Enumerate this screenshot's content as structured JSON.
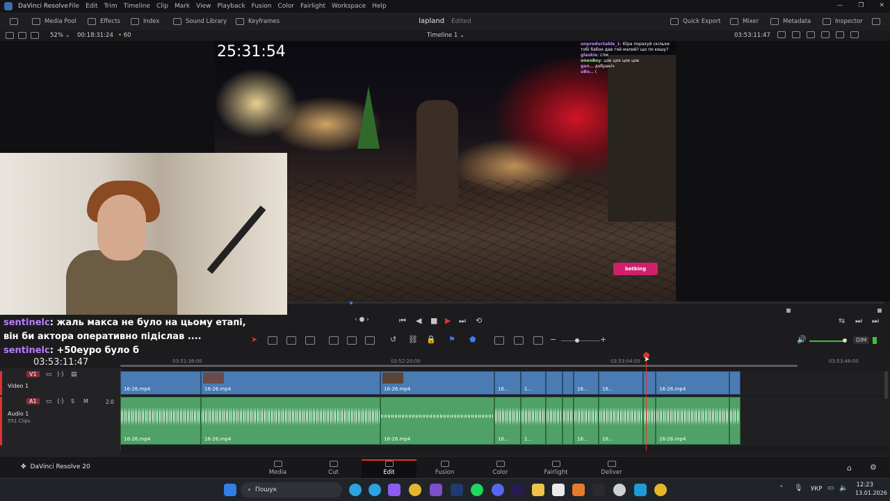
{
  "app": {
    "name": "DaVinci Resolve",
    "menu": [
      "File",
      "Edit",
      "Trim",
      "Timeline",
      "Clip",
      "Mark",
      "View",
      "Playback",
      "Fusion",
      "Color",
      "Fairlight",
      "Workspace",
      "Help"
    ]
  },
  "toolbar": {
    "left": [
      "Media Pool",
      "Effects",
      "Index",
      "Sound Library",
      "Keyframes"
    ],
    "project": "lapland",
    "project_status": "Edited",
    "right": [
      "Quick Export",
      "Mixer",
      "Metadata",
      "Inspector"
    ]
  },
  "viewer_header": {
    "zoom": "52%",
    "duration": "00:18:31:24",
    "fps": "60",
    "timeline_name": "Timeline 1",
    "timecode": "03:53:11:47"
  },
  "video_overlay": {
    "clock": "25:31:54",
    "chat": [
      {
        "user": "unproductable_1",
        "text": "Юра порахуй скільки тобі бабок дав той малий? що по кешу?"
      },
      {
        "user": "glaskie",
        "text": "спм"
      },
      {
        "user": "onenBoy",
        "text": "цок цок цок цок"
      },
      {
        "user": "gen…",
        "text": "добранiч"
      },
      {
        "user": "uBo…",
        "text": "("
      }
    ],
    "sponsor": "betking"
  },
  "stream_chat": [
    {
      "user": "sentinelc",
      "text": ": жаль макса не було на цьому етапі,"
    },
    {
      "user": "",
      "text": "він би актора оперативно підіслав ...."
    },
    {
      "user": "sentinelc",
      "text": ": +50еуро було б"
    }
  ],
  "timeline": {
    "current_timecode": "03:53:11:47",
    "ruler": [
      "03:51:36:00",
      "03:52:20:00",
      "03:53:04:00",
      "03:53:48:00"
    ],
    "tracks": {
      "v1": {
        "tag": "V1",
        "name": "Video 1"
      },
      "a1": {
        "tag": "A1",
        "name": "Audio 1",
        "clips": "551 Clips",
        "level": "2.0"
      }
    },
    "clip_name": "16-26.mp4",
    "clip_short": "16...",
    "clip_tiny": "1...",
    "dim": "DIM"
  },
  "pages": [
    "Media",
    "Cut",
    "Edit",
    "Fusion",
    "Color",
    "Fairlight",
    "Deliver"
  ],
  "active_page": "Edit",
  "brand": "DaVinci Resolve 20",
  "taskbar": {
    "search": "Пошук",
    "lang": "УКР",
    "time": "12:23",
    "date": "13.01.2026"
  }
}
